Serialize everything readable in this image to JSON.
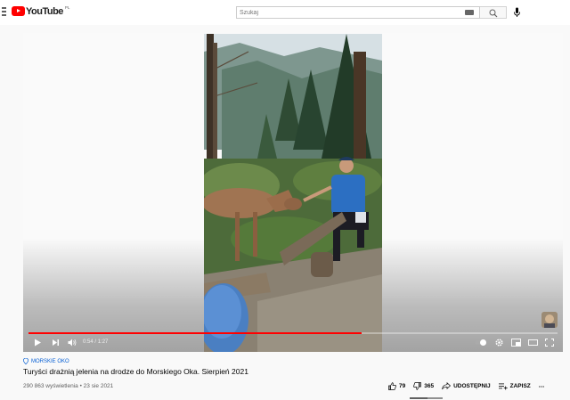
{
  "header": {
    "logo_text": "YouTube",
    "region": "PL",
    "search_placeholder": "Szukaj"
  },
  "player": {
    "time_current": "0:54",
    "time_total": "1:27",
    "progress_fraction": 0.63
  },
  "video": {
    "location_tag": "MORSKIE OKO",
    "title": "Turyści drażnią jelenia na drodze do Morskiego Oka. Sierpień 2021",
    "views_date": "290 863 wyświetlenia • 23 sie 2021",
    "likes": "79",
    "dislikes": "365",
    "share_label": "UDOSTĘPNIJ",
    "save_label": "ZAPISZ",
    "more_label": "⋯"
  },
  "colors": {
    "brand": "#ff0000",
    "link": "#065fd4"
  }
}
